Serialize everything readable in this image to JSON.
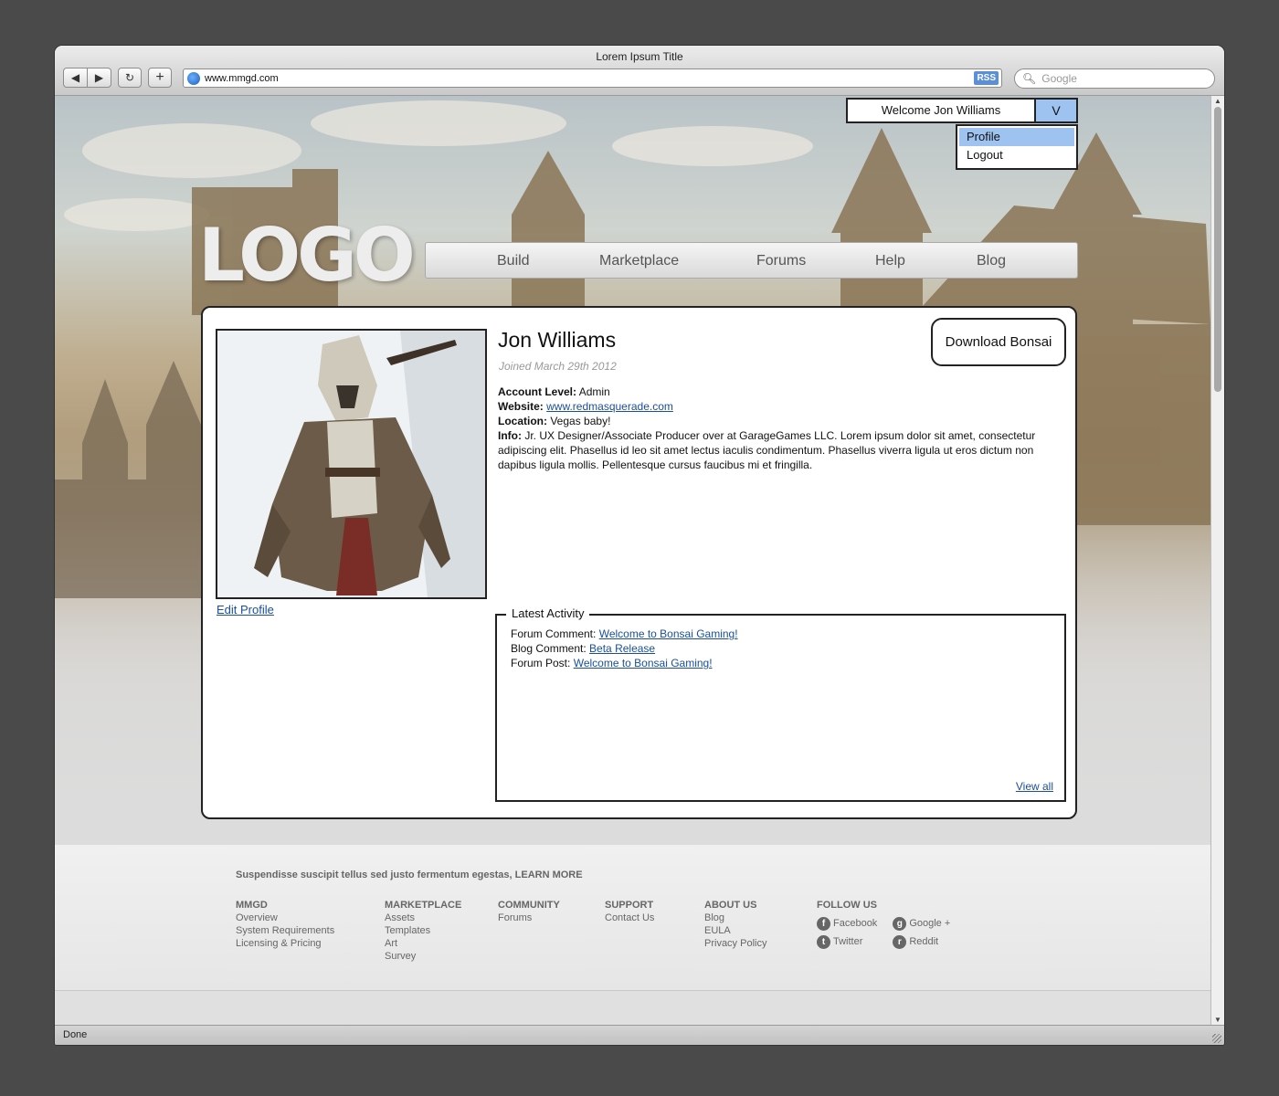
{
  "browser": {
    "title": "Lorem Ipsum Title",
    "back_glyph": "◀",
    "forward_glyph": "▶",
    "reload_glyph": "↻",
    "newtab_glyph": "+",
    "url": "www.mmgd.com",
    "rss_label": "RSS",
    "search_placeholder": "Google",
    "status": "Done"
  },
  "user_menu": {
    "welcome": "Welcome Jon Williams",
    "toggle_label": "V",
    "items": [
      "Profile",
      "Logout"
    ],
    "active_item": "Profile"
  },
  "logo": "LOGO",
  "nav": {
    "items": [
      "Build",
      "Marketplace",
      "Forums",
      "Help",
      "Blog"
    ]
  },
  "profile": {
    "name": "Jon Williams",
    "joined": "Joined March 29th 2012",
    "download_button": "Download Bonsai",
    "edit_link": "Edit Profile",
    "account_level_label": "Account Level:",
    "account_level": "Admin",
    "website_label": "Website:",
    "website": "www.redmasquerade.com",
    "location_label": "Location:",
    "location": "Vegas baby!",
    "info_label": "Info:",
    "info": "Jr. UX Designer/Associate Producer over at GarageGames LLC. Lorem ipsum dolor sit amet, consectetur adipiscing elit. Phasellus id leo sit amet lectus iaculis condimentum. Phasellus viverra ligula ut eros dictum non dapibus ligula mollis. Pellentesque cursus faucibus mi et fringilla."
  },
  "activity": {
    "legend": "Latest Activity",
    "items": [
      {
        "label": "Forum Comment:",
        "link": "Welcome to Bonsai Gaming!"
      },
      {
        "label": "Blog Comment:",
        "link": "Beta Release"
      },
      {
        "label": "Forum Post:",
        "link": "Welcome to Bonsai Gaming!"
      }
    ],
    "view_all": "View all"
  },
  "footer": {
    "tagline": "Suspendisse suscipit tellus sed justo fermentum egestas, LEARN MORE",
    "mmgd": {
      "heading": "MMGD",
      "links": [
        "Overview",
        "System Requirements",
        "Licensing & Pricing"
      ]
    },
    "marketplace": {
      "heading": "MARKETPLACE",
      "links": [
        "Assets",
        "Templates",
        "Art",
        "Survey"
      ]
    },
    "community": {
      "heading": "COMMUNITY",
      "links": [
        "Forums"
      ]
    },
    "support": {
      "heading": "SUPPORT",
      "links": [
        "Contact Us"
      ]
    },
    "about": {
      "heading": "ABOUT US",
      "links": [
        "Blog",
        "EULA",
        "Privacy Policy"
      ]
    },
    "follow": {
      "heading": "FOLLOW US",
      "facebook": "Facebook",
      "google": "Google +",
      "twitter": "Twitter",
      "reddit": "Reddit"
    }
  },
  "colors": {
    "link": "#1a4f9c",
    "highlight": "#9ec3f0",
    "page_bg": "#4a4a4a"
  }
}
